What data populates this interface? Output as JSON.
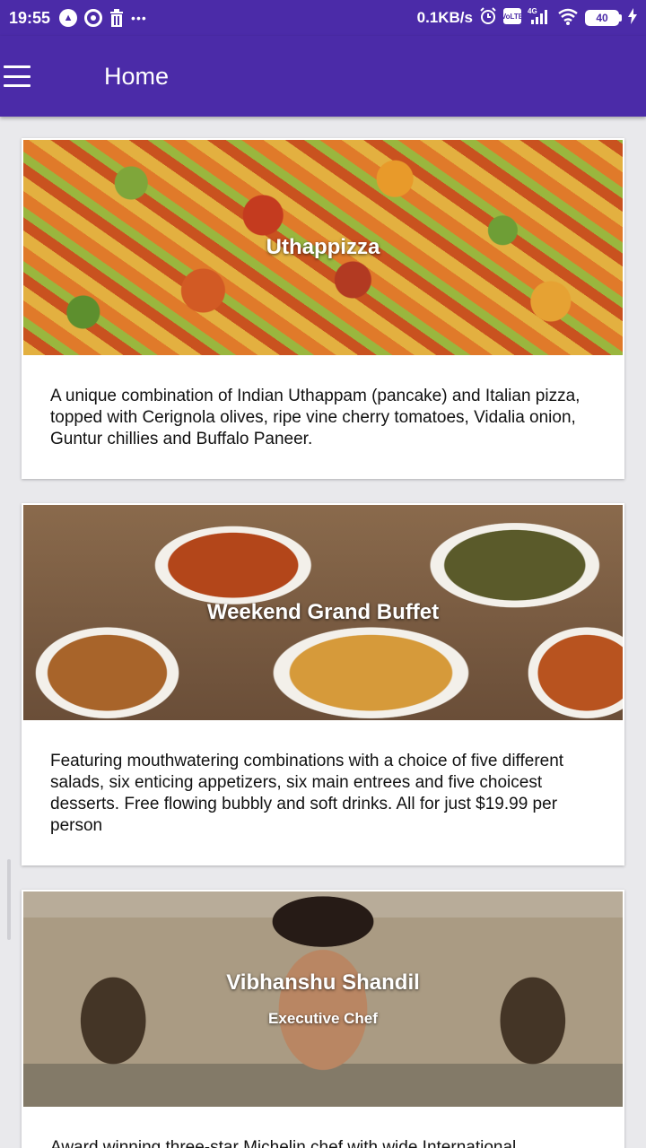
{
  "status_bar": {
    "time": "19:55",
    "network_speed": "0.1KB/s",
    "network_type": "4G",
    "battery": "40",
    "icons": [
      "app-a-icon",
      "record-icon",
      "trash-icon",
      "more-dots-icon",
      "alarm-icon",
      "volte-icon",
      "signal-icon",
      "wifi-icon",
      "battery-icon",
      "charging-icon"
    ]
  },
  "app_bar": {
    "title": "Home",
    "menu_icon": "hamburger-menu-icon",
    "background": "#4b2ba8"
  },
  "cards": [
    {
      "title": "Uthappizza",
      "subtitle": "",
      "description": "A unique combination of Indian Uthappam (pancake) and Italian pizza, topped with Cerignola olives, ripe vine cherry tomatoes, Vidalia onion, Guntur chillies and Buffalo Paneer."
    },
    {
      "title": "Weekend Grand Buffet",
      "subtitle": "",
      "description": "Featuring mouthwatering combinations with a choice of five different salads, six enticing appetizers, six main entrees and five choicest desserts. Free flowing bubbly and soft drinks. All for just $19.99 per person"
    },
    {
      "title": "Vibhanshu Shandil",
      "subtitle": "Executive Chef",
      "description": "Award winning three-star Michelin chef with wide International"
    }
  ]
}
